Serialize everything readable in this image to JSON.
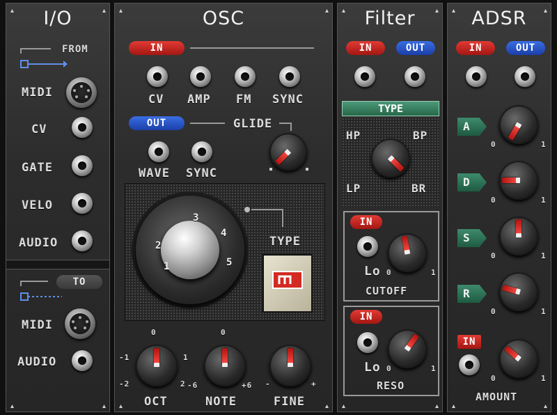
{
  "io": {
    "title": "I/O",
    "from_label": "FROM",
    "to_label": "TO",
    "midi": "MIDI",
    "cv": "CV",
    "gate": "GATE",
    "velo": "VELO",
    "audio": "AUDIO",
    "midi2": "MIDI",
    "audio2": "AUDIO"
  },
  "osc": {
    "title": "OSC",
    "in": "IN",
    "out": "OUT",
    "cv": "CV",
    "amp": "AMP",
    "fm": "FM",
    "sync": "SYNC",
    "glide": "GLIDE",
    "wave": "WAVE",
    "sync2": "SYNC",
    "type": "TYPE",
    "wave_marks": [
      "1",
      "2",
      "3",
      "4",
      "5"
    ],
    "oct": {
      "label": "OCT",
      "min": "-2",
      "minor": "-1",
      "zero": "0",
      "plus": "1",
      "max": "2"
    },
    "note": {
      "label": "NOTE",
      "min": "-6",
      "zero": "0",
      "max": "+6"
    },
    "fine": {
      "label": "FINE",
      "min": "-",
      "max": "+"
    }
  },
  "filter": {
    "title": "Filter",
    "in": "IN",
    "out": "OUT",
    "type": "TYPE",
    "hp": "HP",
    "bp": "BP",
    "lp": "LP",
    "br": "BR",
    "cutoff": {
      "label": "CUTOFF",
      "lo": "Lo",
      "zero": "0",
      "one": "1",
      "in": "IN"
    },
    "reso": {
      "label": "RESO",
      "lo": "Lo",
      "zero": "0",
      "one": "1",
      "in": "IN"
    }
  },
  "adsr": {
    "title": "ADSR",
    "in": "IN",
    "out": "OUT",
    "a": "A",
    "d": "D",
    "s": "S",
    "r": "R",
    "zero": "0",
    "one": "1",
    "amount_in": "IN",
    "amount": "AMOUNT"
  },
  "colors": {
    "accent_red": "#d8261f",
    "accent_blue": "#2f5fd6",
    "type_green": "#3e8a6d"
  }
}
